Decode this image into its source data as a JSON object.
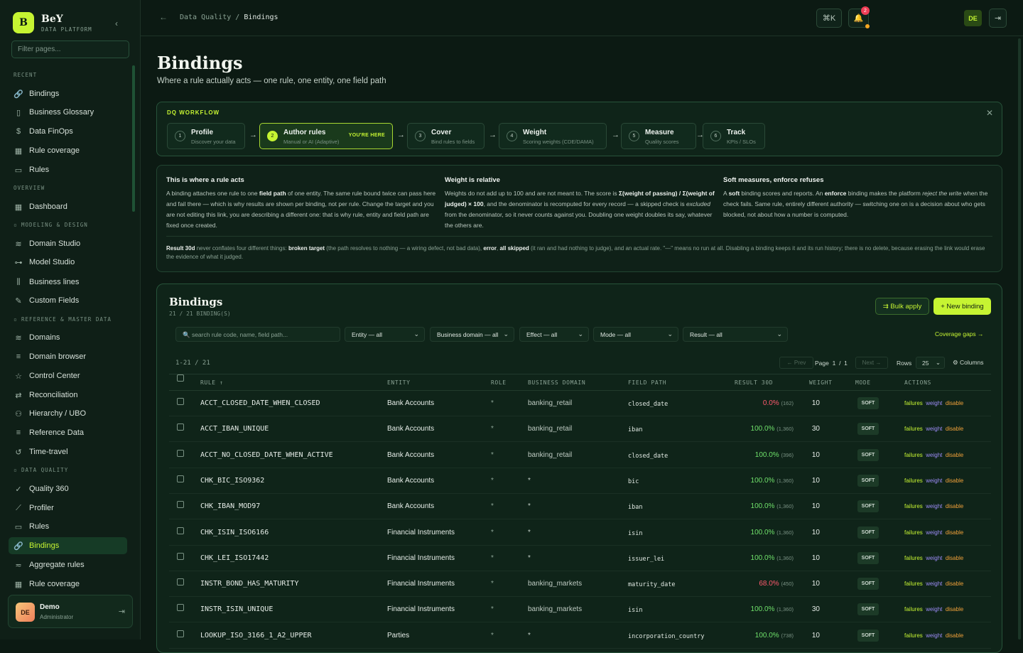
{
  "brand": {
    "initial": "B",
    "name": "BeY",
    "sub": "DATA PLATFORM"
  },
  "sidebar": {
    "filter_placeholder": "Filter pages...",
    "sections": {
      "recent": "RECENT",
      "overview": "OVERVIEW",
      "modeling": "MODELING & DESIGN",
      "reference": "REFERENCE & MASTER DATA",
      "dq": "DATA QUALITY"
    },
    "items": [
      {
        "label": "Bindings",
        "icon": "link-icon"
      },
      {
        "label": "Business Glossary",
        "icon": "book-icon"
      },
      {
        "label": "Data FinOps",
        "icon": "dollar-icon"
      },
      {
        "label": "Rule coverage",
        "icon": "grid-icon"
      },
      {
        "label": "Rules",
        "icon": "clipboard-icon"
      },
      {
        "label": "Dashboard",
        "icon": "grid-icon"
      },
      {
        "label": "Domain Studio",
        "icon": "layers-icon"
      },
      {
        "label": "Model Studio",
        "icon": "model-icon"
      },
      {
        "label": "Business lines",
        "icon": "bars-icon"
      },
      {
        "label": "Custom Fields",
        "icon": "pencil-icon"
      },
      {
        "label": "Domains",
        "icon": "layers-icon"
      },
      {
        "label": "Domain browser",
        "icon": "list-icon"
      },
      {
        "label": "Control Center",
        "icon": "star-icon"
      },
      {
        "label": "Reconciliation",
        "icon": "swap-icon"
      },
      {
        "label": "Hierarchy / UBO",
        "icon": "hierarchy-icon"
      },
      {
        "label": "Reference Data",
        "icon": "list-icon"
      },
      {
        "label": "Time-travel",
        "icon": "history-icon"
      },
      {
        "label": "Quality 360",
        "icon": "check-circle-icon"
      },
      {
        "label": "Profiler",
        "icon": "chart-icon"
      },
      {
        "label": "Rules",
        "icon": "clipboard-icon"
      },
      {
        "label": "Bindings",
        "icon": "link-icon"
      },
      {
        "label": "Aggregate rules",
        "icon": "filter-icon"
      },
      {
        "label": "Rule coverage",
        "icon": "grid-icon"
      }
    ]
  },
  "user": {
    "initials": "DE",
    "name": "Demo",
    "role": "Administrator"
  },
  "topbar": {
    "crumb_parent": "Data Quality",
    "crumb_sep": "/",
    "crumb_current": "Bindings",
    "shortcut": "⌘K",
    "notif_count": "2",
    "avatar": "DE"
  },
  "page": {
    "title": "Bindings",
    "subtitle": "Where a rule actually acts — one rule, one entity, one field path"
  },
  "workflow": {
    "title": "DQ WORKFLOW",
    "here": "YOU'RE HERE",
    "steps": [
      {
        "n": "1",
        "label": "Profile",
        "desc": "Discover your data"
      },
      {
        "n": "2",
        "label": "Author rules",
        "desc": "Manual or AI (Adaptive)"
      },
      {
        "n": "3",
        "label": "Cover",
        "desc": "Bind rules to fields"
      },
      {
        "n": "4",
        "label": "Weight",
        "desc": "Scoring weights (CDE/DAMA)"
      },
      {
        "n": "5",
        "label": "Measure",
        "desc": "Quality scores"
      },
      {
        "n": "6",
        "label": "Track",
        "desc": "KPIs / SLOs"
      }
    ]
  },
  "info": {
    "c1_title": "This is where a rule acts",
    "c1_a": "A binding attaches one rule to one ",
    "c1_b": "field path",
    "c1_c": " of one entity. The same rule bound twice can pass here and fail there — which is why results are shown per binding, not per rule. Change the target and you are not editing this link, you are describing a different one: that is why rule, entity and field path are fixed once created.",
    "c2_title": "Weight is relative",
    "c2_a": "Weights do not add up to 100 and are not meant to. The score is ",
    "c2_b": "Σ(weight of passing) / Σ(weight of judged) × 100",
    "c2_c": ", and the denominator is recomputed for every record — a skipped check is ",
    "c2_d": "excluded",
    "c2_e": " from the denominator, so it never counts against you. Doubling one weight doubles its say, whatever the others are.",
    "c3_title": "Soft measures, enforce refuses",
    "c3_a": "A ",
    "c3_b": "soft",
    "c3_c": " binding scores and reports. An ",
    "c3_d": "enforce",
    "c3_e": " binding makes the platform ",
    "c3_f": "reject the write",
    "c3_g": " when the check fails. Same rule, entirely different authority — switching one on is a decision about who gets blocked, not about how a number is computed.",
    "n_a": "Result 30d",
    "n_b": " never conflates four different things: ",
    "n_c": "broken target",
    "n_d": " (the path resolves to nothing — a wiring defect, not bad data), ",
    "n_e": "error",
    "n_f": ", ",
    "n_g": "all skipped",
    "n_h": " (it ran and had nothing to judge), and an actual rate. \"—\" means no run at all. Disabling a binding keeps it and its run history; there is no delete, because erasing the link would erase the evidence of what it judged."
  },
  "panel": {
    "title": "Bindings",
    "count": "21 / 21 BINDING(S)",
    "bulk": "⇉ Bulk apply",
    "new": "+ New binding",
    "search_placeholder": "search rule code, name, field path...",
    "filters": [
      "Entity — all",
      "Business domain — all",
      "Effect — all",
      "Mode — all",
      "Result — all"
    ],
    "gaps": "Coverage gaps →",
    "range": "1-21 / 21",
    "prev": "← Prev",
    "page_label": "Page",
    "page": "1",
    "of": "/",
    "pages": "1",
    "next": "Next →",
    "rows_label": "Rows",
    "rows": "25",
    "columns": "⚙ Columns"
  },
  "table": {
    "headers": [
      "RULE ↑",
      "ENTITY",
      "ROLE",
      "BUSINESS DOMAIN",
      "FIELD PATH",
      "RESULT 30D",
      "WEIGHT",
      "MODE",
      "ACTIONS"
    ],
    "actions": [
      "failures",
      "weight",
      "disable"
    ],
    "rows": [
      {
        "rule": "ACCT_CLOSED_DATE_WHEN_CLOSED",
        "entity": "Bank Accounts",
        "role": "*",
        "domain": "banking_retail",
        "path": "closed_date",
        "rate": "0.0%",
        "n": "(162)",
        "w": "10",
        "mode": "SOFT"
      },
      {
        "rule": "ACCT_IBAN_UNIQUE",
        "entity": "Bank Accounts",
        "role": "*",
        "domain": "banking_retail",
        "path": "iban",
        "rate": "100.0%",
        "n": "(1,360)",
        "w": "30",
        "mode": "SOFT"
      },
      {
        "rule": "ACCT_NO_CLOSED_DATE_WHEN_ACTIVE",
        "entity": "Bank Accounts",
        "role": "*",
        "domain": "banking_retail",
        "path": "closed_date",
        "rate": "100.0%",
        "n": "(396)",
        "w": "10",
        "mode": "SOFT"
      },
      {
        "rule": "CHK_BIC_ISO9362",
        "entity": "Bank Accounts",
        "role": "*",
        "domain": "*",
        "path": "bic",
        "rate": "100.0%",
        "n": "(1,360)",
        "w": "10",
        "mode": "SOFT"
      },
      {
        "rule": "CHK_IBAN_MOD97",
        "entity": "Bank Accounts",
        "role": "*",
        "domain": "*",
        "path": "iban",
        "rate": "100.0%",
        "n": "(1,360)",
        "w": "10",
        "mode": "SOFT"
      },
      {
        "rule": "CHK_ISIN_ISO6166",
        "entity": "Financial Instruments",
        "role": "*",
        "domain": "*",
        "path": "isin",
        "rate": "100.0%",
        "n": "(1,360)",
        "w": "10",
        "mode": "SOFT"
      },
      {
        "rule": "CHK_LEI_ISO17442",
        "entity": "Financial Instruments",
        "role": "*",
        "domain": "*",
        "path": "issuer_lei",
        "rate": "100.0%",
        "n": "(1,360)",
        "w": "10",
        "mode": "SOFT"
      },
      {
        "rule": "INSTR_BOND_HAS_MATURITY",
        "entity": "Financial Instruments",
        "role": "*",
        "domain": "banking_markets",
        "path": "maturity_date",
        "rate": "68.0%",
        "n": "(450)",
        "w": "10",
        "mode": "SOFT"
      },
      {
        "rule": "INSTR_ISIN_UNIQUE",
        "entity": "Financial Instruments",
        "role": "*",
        "domain": "banking_markets",
        "path": "isin",
        "rate": "100.0%",
        "n": "(1,360)",
        "w": "30",
        "mode": "SOFT"
      },
      {
        "rule": "LOOKUP_ISO_3166_1_A2_UPPER",
        "entity": "Parties",
        "role": "*",
        "domain": "*",
        "path": "incorporation_country",
        "rate": "100.0%",
        "n": "(738)",
        "w": "10",
        "mode": "SOFT"
      }
    ]
  },
  "colors": {
    "accent": "#c6f432",
    "pass": "#6fe06a",
    "fail": "#ff5a6e",
    "weight": "#9d8cf8",
    "disable": "#f2a23a"
  }
}
